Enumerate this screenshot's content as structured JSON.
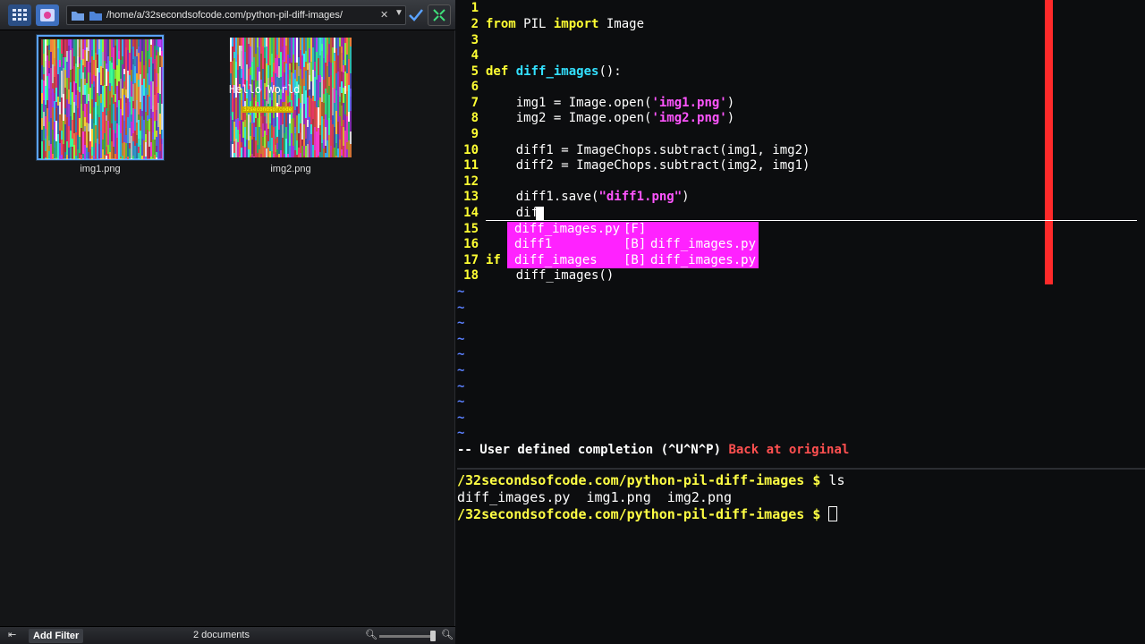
{
  "file_manager": {
    "path": "/home/a/32secondsofcode.com/python-pil-diff-images/",
    "items": [
      {
        "name": "img1.png",
        "selected": true
      },
      {
        "name": "img2.png",
        "selected": false,
        "overlay_text": "Hello World",
        "overlay_subtext": "32secondsofcode"
      }
    ],
    "status": {
      "add_filter_label": "Add Filter",
      "document_count": "2 documents"
    }
  },
  "editor": {
    "lines": {
      "n1": "1",
      "n2": "2",
      "n3": "3",
      "n4": "4",
      "n5": "5",
      "n6": "6",
      "n7": "7",
      "n8": "8",
      "n9": "9",
      "n10": "10",
      "n11": "11",
      "n12": "12",
      "n13": "13",
      "n14": "14",
      "n15": "15",
      "n16": "16",
      "n17": "17",
      "n18": "18"
    },
    "code": {
      "l2_from": "from",
      "l2_mod": " PIL ",
      "l2_import": "import",
      "l2_rest": " Image",
      "l5_def": "def",
      "l5_name": "diff_images",
      "l5_rest": "():",
      "l7_a": "    img1 = Image.open(",
      "l7_s": "'img1.png'",
      "l7_b": ")",
      "l8_a": "    img2 = Image.open(",
      "l8_s": "'img2.png'",
      "l8_b": ")",
      "l10": "    diff1 = ImageChops.subtract(img1, img2)",
      "l11": "    diff2 = ImageChops.subtract(img2, img1)",
      "l13_a": "    diff1.save(",
      "l13_s": "\"diff1.png\"",
      "l13_b": ")",
      "l14": "    dif",
      "l17_if": "if",
      "l18": "    diff_images()"
    },
    "completion": [
      {
        "word": "diff_images.py",
        "kind": "[F]",
        "file": ""
      },
      {
        "word": "diff1",
        "kind": "[B]",
        "file": "diff_images.py"
      },
      {
        "word": "diff_images",
        "kind": "[B]",
        "file": "diff_images.py"
      }
    ],
    "mode_line": "-- User defined completion (^U^N^P) ",
    "mode_msg": "Back at original",
    "colors": {
      "linenr": "#ffff33",
      "keyword": "#ffff33",
      "function": "#33e0ff",
      "string": "#ff55ff",
      "popup": "#ff22ff",
      "colorcolumn": "#ff2a2a",
      "tilde": "#5b80ff"
    }
  },
  "terminal": {
    "prompt": "/32secondsofcode.com/python-pil-diff-images $ ",
    "cmd1": "ls",
    "output": "diff_images.py  img1.png  img2.png"
  }
}
